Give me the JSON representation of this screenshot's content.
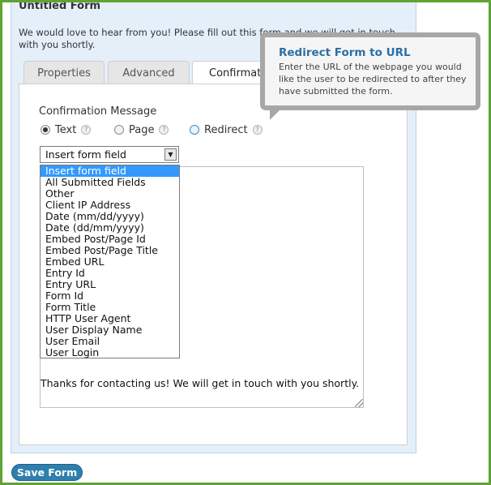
{
  "form": {
    "title": "Untitled Form",
    "description": "We would love to hear from you! Please fill out this form and we will get in touch with you shortly."
  },
  "tabs": [
    {
      "label": "Properties"
    },
    {
      "label": "Advanced"
    },
    {
      "label": "Confirmation"
    }
  ],
  "confirmation": {
    "label": "Confirmation Message",
    "options": [
      {
        "label": "Text",
        "checked": true
      },
      {
        "label": "Page",
        "checked": false
      },
      {
        "label": "Redirect",
        "checked": false
      }
    ],
    "select_value": "Insert form field",
    "message": "Thanks for contacting us! We will get in touch with you shortly."
  },
  "dropdown": {
    "items": [
      "Insert form field",
      "All Submitted Fields",
      "Other",
      "Client IP Address",
      "Date (mm/dd/yyyy)",
      "Date (dd/mm/yyyy)",
      "Embed Post/Page Id",
      "Embed Post/Page Title",
      "Embed URL",
      "Entry Id",
      "Entry URL",
      "Form Id",
      "Form Title",
      "HTTP User Agent",
      "User Display Name",
      "User Email",
      "User Login"
    ]
  },
  "tooltip": {
    "title": "Redirect Form to URL",
    "body": "Enter the URL of the webpage you would like the user to be redirected to after they have submitted the form."
  },
  "actions": {
    "save_label": "Save Form"
  },
  "icons": {
    "help": "question-mark-icon",
    "select_arrow": "triangle-down-icon"
  },
  "colors": {
    "frame": "#5fa334",
    "panel": "#e4eff9",
    "tooltip_title": "#2a6fa7",
    "selection": "#3399ff",
    "save_button": "#2e7fae"
  }
}
